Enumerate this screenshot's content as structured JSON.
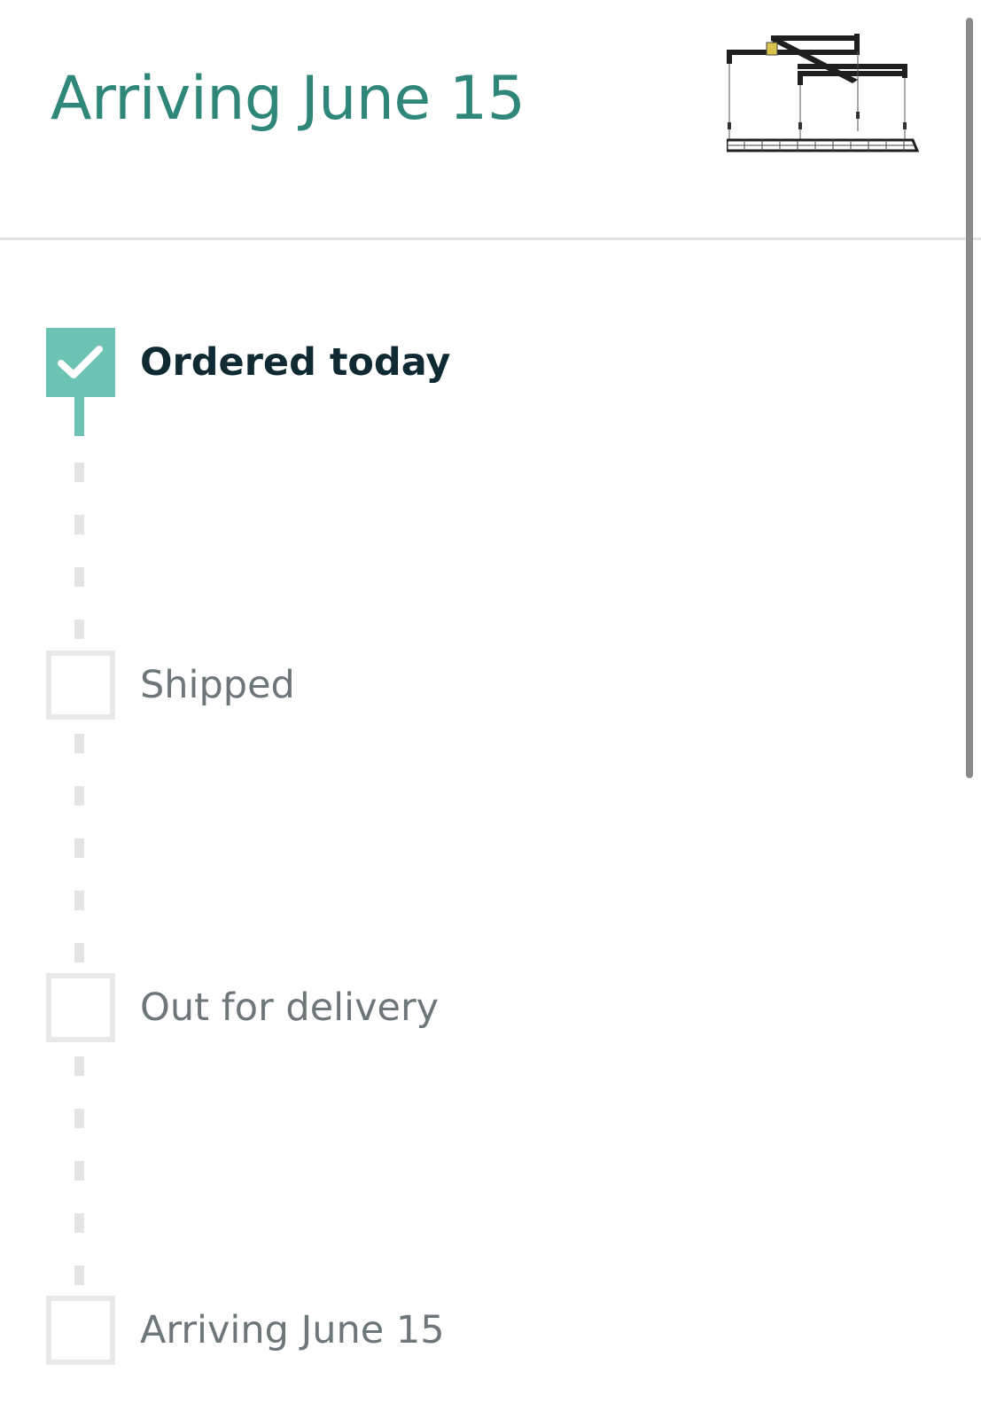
{
  "header": {
    "title": "Arriving June 15",
    "product_image": "ceiling-storage-rack-image"
  },
  "tracker": {
    "steps": [
      {
        "label": "Ordered today",
        "status": "done",
        "icon": "checkmark-icon"
      },
      {
        "label": "Shipped",
        "status": "pending",
        "icon": "empty-checkbox-icon"
      },
      {
        "label": "Out for delivery",
        "status": "pending",
        "icon": "empty-checkbox-icon"
      },
      {
        "label": "Arriving June 15",
        "status": "pending",
        "icon": "empty-checkbox-icon"
      }
    ],
    "progress_steps_complete": 1,
    "progress_steps_total": 4
  },
  "colors": {
    "accent": "#2e8779",
    "done_fill": "#6cc3b3",
    "pending_border": "#e9e9e9",
    "done_text": "#102a33",
    "pending_text": "#6d7679"
  }
}
